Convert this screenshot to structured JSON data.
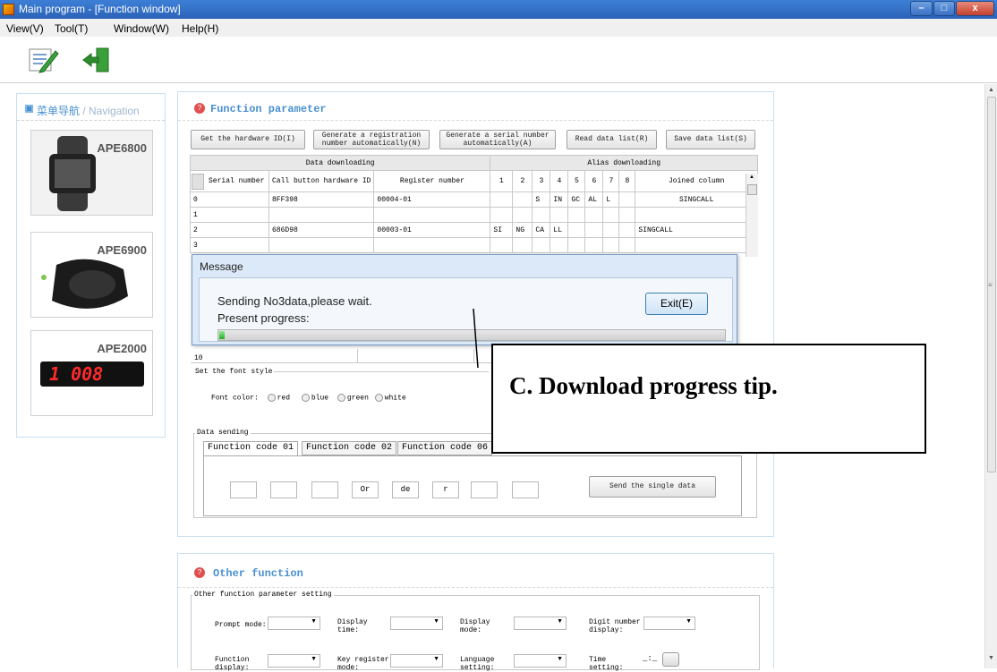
{
  "window": {
    "title": "Main program - [Function window]",
    "minimize": "–",
    "maximize": "□",
    "close": "x"
  },
  "menu": [
    "View(V)",
    "Tool(T)",
    "Window(W)",
    "Help(H)"
  ],
  "nav": {
    "title_cn": "菜单导航",
    "title_en": " / Navigation",
    "items": [
      {
        "label": "APE6800"
      },
      {
        "label": "APE6900"
      },
      {
        "label": "APE2000",
        "display": "1 008"
      }
    ]
  },
  "function_param": {
    "title": "Function parameter",
    "buttons": {
      "get_hw": "Get the hardware ID(I)",
      "gen_reg": "Generate a registration number automatically(N)",
      "gen_serial": "Generate a serial number automatically(A)",
      "read": "Read data list(R)",
      "save": "Save data list(S)"
    },
    "group_headers": [
      "Data downloading",
      "Alias downloading"
    ],
    "columns": [
      "Serial number",
      "Call button hardware ID",
      "Register number",
      "1",
      "2",
      "3",
      "4",
      "5",
      "6",
      "7",
      "8",
      "Joined column"
    ],
    "rows": [
      [
        "0",
        "8FF398",
        "00004-01",
        "",
        "",
        "S",
        "IN",
        "GC",
        "AL",
        "L",
        "",
        "SINGCALL"
      ],
      [
        "1",
        "",
        "",
        "",
        "",
        "",
        "",
        "",
        "",
        "",
        "",
        ""
      ],
      [
        "2",
        "686D98",
        "00003-01",
        "SI",
        "NG",
        "CA",
        "LL",
        "",
        "",
        "",
        "",
        "SINGCALL"
      ],
      [
        "3",
        "",
        "",
        "",
        "",
        "",
        "",
        "",
        "",
        "",
        "",
        ""
      ]
    ],
    "last_row_serial": "10",
    "font_style": {
      "legend": "Set the font style",
      "label": "Font color:",
      "options": [
        "red",
        "blue",
        "green",
        "white"
      ]
    },
    "data_sending": {
      "legend": "Data sending",
      "tabs": [
        "Function code 01",
        "Function code 02",
        "Function code 06"
      ],
      "fields": [
        "",
        "",
        "",
        "Or",
        "de",
        "r",
        "",
        ""
      ],
      "send_button": "Send the single data"
    }
  },
  "dialog": {
    "title": "Message",
    "message": "Sending No3data,please wait.",
    "progress_label": "Present progress:",
    "exit_button": "Exit(E)",
    "progress": 0.01
  },
  "callout": {
    "text": "C. Download progress tip."
  },
  "other_function": {
    "title": "Other function",
    "legend": "Other function parameter setting",
    "labels": {
      "prompt_mode": "Prompt mode:",
      "display_time": "Display time:",
      "display_mode": "Display mode:",
      "digit_number": "Digit number display:",
      "function_display": "Function display:",
      "key_register": "Key register mode:",
      "language": "Language setting:",
      "time": "Time setting:"
    },
    "time_value": "_:_"
  }
}
